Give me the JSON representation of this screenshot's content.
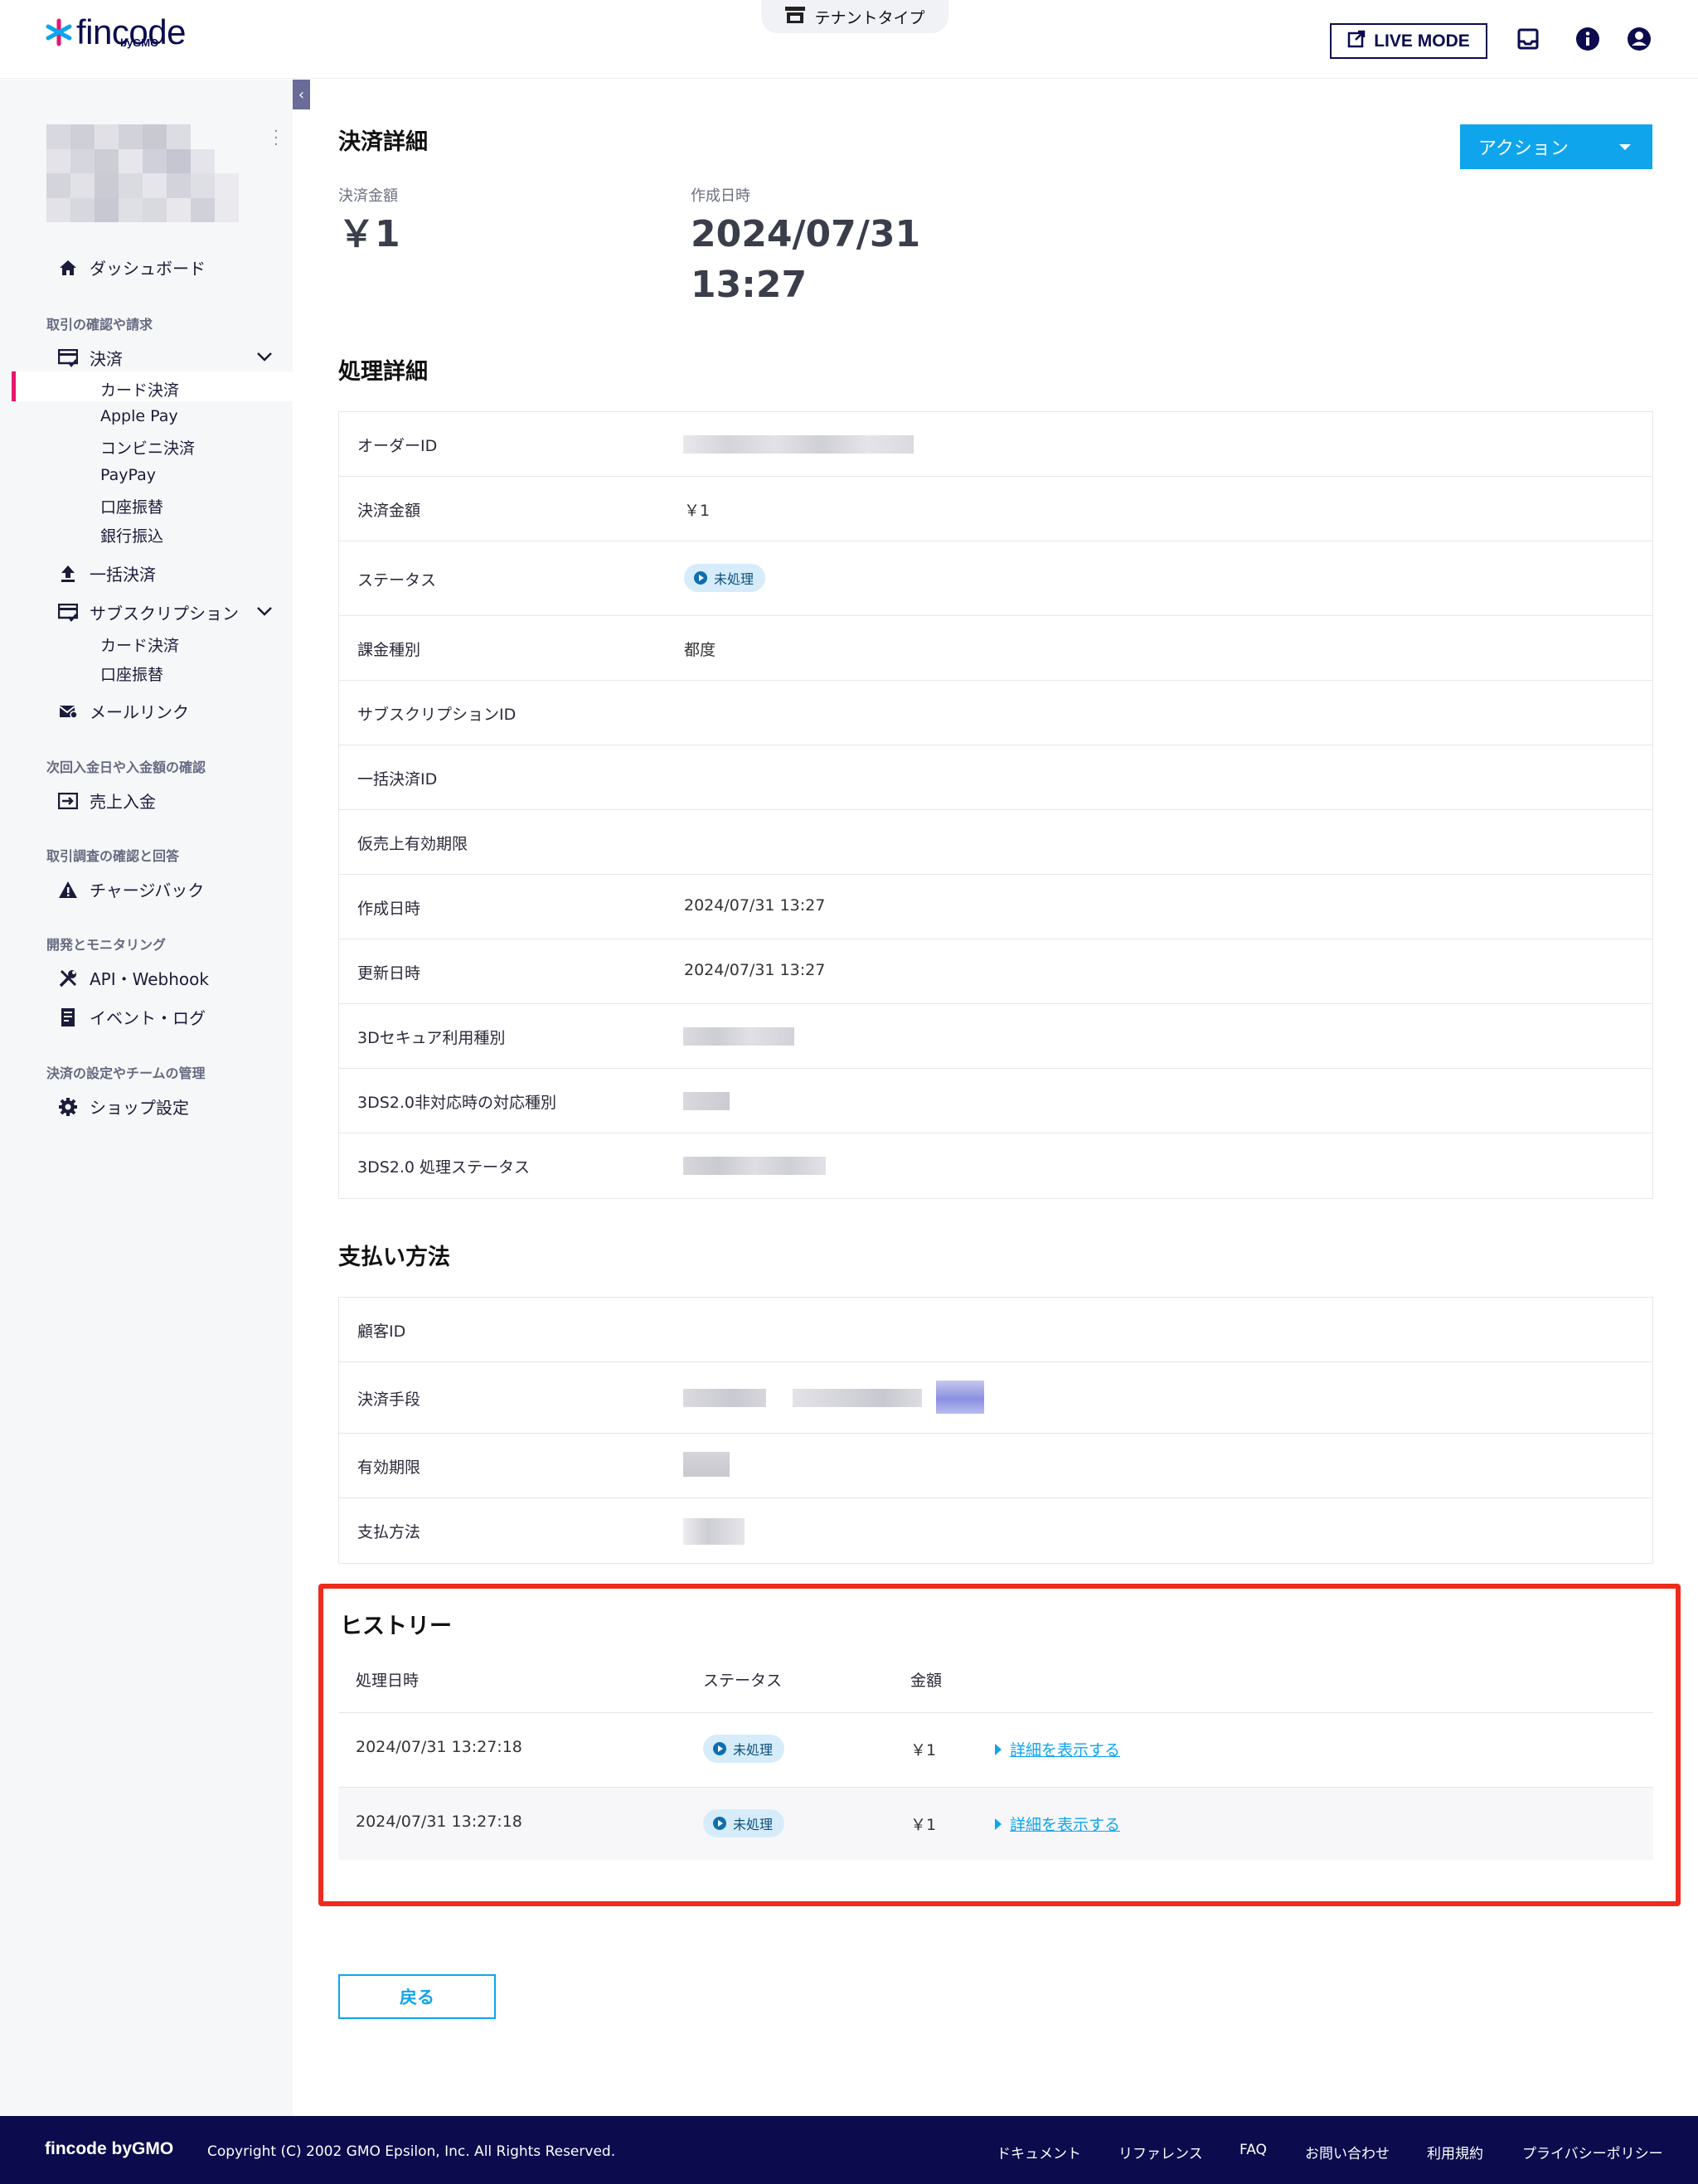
{
  "header": {
    "logo_text": "fincode",
    "logo_sub": "byGMO",
    "tenant_label": "テナントタイプ",
    "live_mode_label": "LIVE MODE"
  },
  "sidebar": {
    "dashboard": "ダッシュボード",
    "section_transactions": "取引の確認や請求",
    "payments": "決済",
    "payments_sub": [
      "カード決済",
      "Apple Pay",
      "コンビニ決済",
      "PayPay",
      "口座振替",
      "銀行振込"
    ],
    "bulk": "一括決済",
    "subscription": "サブスクリプション",
    "subscription_sub": [
      "カード決済",
      "口座振替"
    ],
    "mail_link": "メールリンク",
    "section_deposit": "次回入金日や入金額の確認",
    "sales_deposit": "売上入金",
    "section_dispute": "取引調査の確認と回答",
    "chargeback": "チャージバック",
    "section_dev": "開発とモニタリング",
    "api_webhook": "API・Webhook",
    "event_log": "イベント・ログ",
    "section_settings": "決済の設定やチームの管理",
    "shop_settings": "ショップ設定"
  },
  "payment_detail": {
    "title": "決済詳細",
    "amount_label": "決済金額",
    "amount_value": "￥1",
    "created_label": "作成日時",
    "created_date": "2024/07/31",
    "created_time": "13:27",
    "action_label": "アクション"
  },
  "processing": {
    "title": "処理詳細",
    "rows": [
      {
        "key": "オーダーID",
        "value": ""
      },
      {
        "key": "決済金額",
        "value": "￥1"
      },
      {
        "key": "ステータス",
        "value": "未処理"
      },
      {
        "key": "課金種別",
        "value": "都度"
      },
      {
        "key": "サブスクリプションID",
        "value": ""
      },
      {
        "key": "一括決済ID",
        "value": ""
      },
      {
        "key": "仮売上有効期限",
        "value": ""
      },
      {
        "key": "作成日時",
        "value": "2024/07/31 13:27"
      },
      {
        "key": "更新日時",
        "value": "2024/07/31 13:27"
      },
      {
        "key": "3Dセキュア利用種別",
        "value": ""
      },
      {
        "key": "3DS2.0非対応時の対応種別",
        "value": ""
      },
      {
        "key": "3DS2.0 処理ステータス",
        "value": ""
      }
    ]
  },
  "payment_method": {
    "title": "支払い方法",
    "rows": [
      {
        "key": "顧客ID"
      },
      {
        "key": "決済手段"
      },
      {
        "key": "有効期限"
      },
      {
        "key": "支払方法"
      }
    ]
  },
  "history": {
    "title": "ヒストリー",
    "col_date": "処理日時",
    "col_status": "ステータス",
    "col_amount": "金額",
    "rows": [
      {
        "date": "2024/07/31 13:27:18",
        "status": "未処理",
        "amount": "￥1",
        "link": "詳細を表示する"
      },
      {
        "date": "2024/07/31 13:27:18",
        "status": "未処理",
        "amount": "￥1",
        "link": "詳細を表示する"
      }
    ]
  },
  "back_label": "戻る",
  "footer": {
    "brand": "fincode byGMO",
    "copyright": "Copyright (C) 2002 GMO Epsilon, Inc. All Rights Reserved.",
    "links": [
      "ドキュメント",
      "リファレンス",
      "FAQ",
      "お問い合わせ",
      "利用規約",
      "プライバシーポリシー"
    ]
  },
  "colors": {
    "accent": "#0ea5ed",
    "navy": "#0b0b4e",
    "active_marker": "#e8156e",
    "highlight_frame": "#ee2b1c"
  }
}
